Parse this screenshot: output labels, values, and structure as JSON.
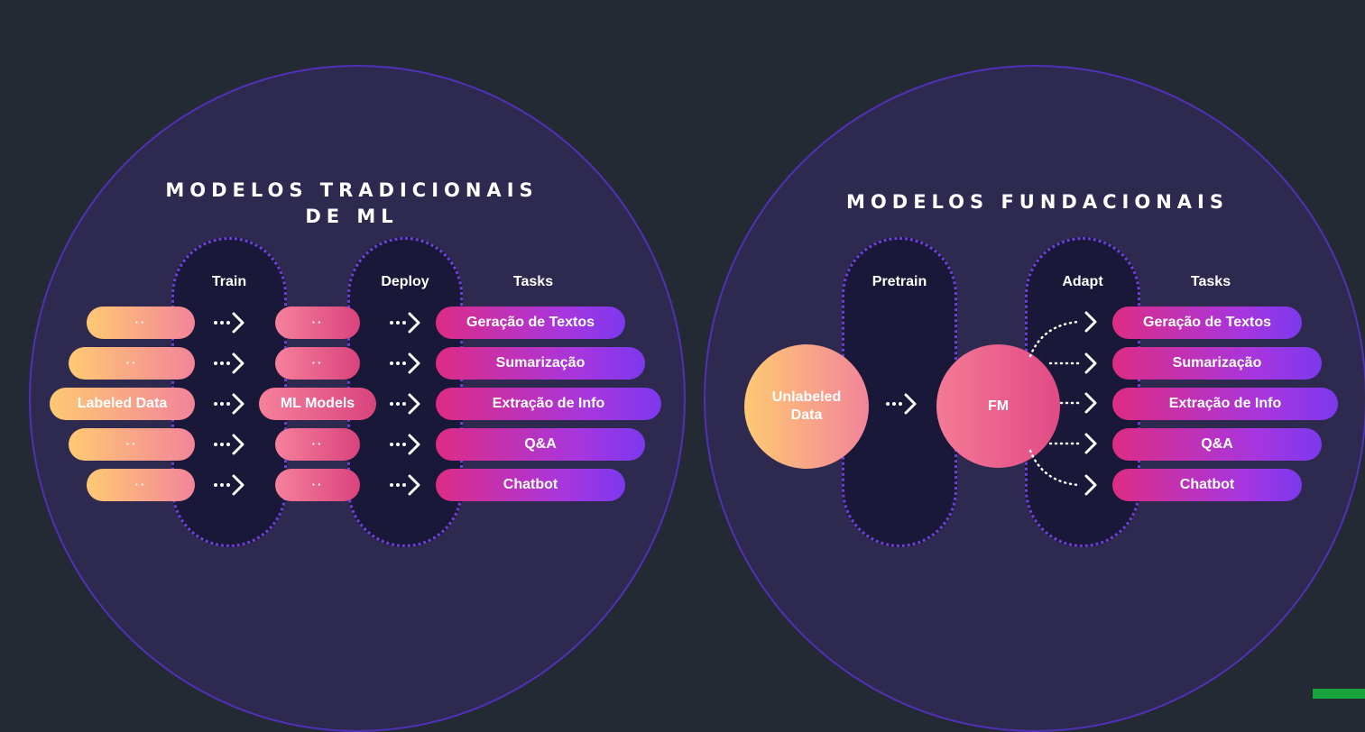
{
  "colors": {
    "background": "#232a33",
    "panel": "#2e2a4f",
    "panel_border": "#5130b8",
    "column": "#1a1838",
    "column_border": "#6d3ed8",
    "data_gradient": [
      "#ffc973",
      "#f2849a"
    ],
    "model_gradient": [
      "#f6809c",
      "#d9437c"
    ],
    "task_gradient": [
      "#dd2c85",
      "#a536e0",
      "#7c38ee"
    ]
  },
  "traditional": {
    "title_line1": "MODELOS TRADICIONAIS",
    "title_line2": "DE ML",
    "train_label": "Train",
    "deploy_label": "Deploy",
    "tasks_label": "Tasks",
    "data_items": [
      "··",
      "··",
      "Labeled Data",
      "··",
      "··"
    ],
    "model_items": [
      "··",
      "··",
      "ML Models",
      "··",
      "··"
    ],
    "tasks": [
      "Geração de Textos",
      "Sumarização",
      "Extração de Info",
      "Q&A",
      "Chatbot"
    ]
  },
  "foundational": {
    "title": "MODELOS FUNDACIONAIS",
    "pretrain_label": "Pretrain",
    "adapt_label": "Adapt",
    "tasks_label": "Tasks",
    "input_label": "Unlabeled Data",
    "model_label": "FM",
    "tasks": [
      "Geração de Textos",
      "Sumarização",
      "Extração de Info",
      "Q&A",
      "Chatbot"
    ]
  }
}
